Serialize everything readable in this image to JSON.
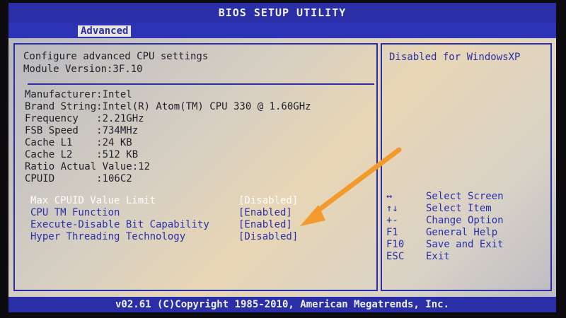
{
  "title": "BIOS SETUP UTILITY",
  "tab": "Advanced",
  "header": {
    "line1": "Configure advanced CPU settings",
    "line2": "Module Version:3F.10"
  },
  "info": [
    "Manufacturer:Intel",
    "Brand String:Intel(R) Atom(TM) CPU 330 @ 1.60GHz",
    "Frequency   :2.21GHz",
    "FSB Speed   :734MHz",
    "Cache L1    :24 KB",
    "Cache L2    :512 KB",
    "Ratio Actual Value:12",
    "CPUID       :106C2"
  ],
  "options": [
    {
      "label": "Max CPUID Value Limit",
      "value": "[Disabled]"
    },
    {
      "label": "CPU TM Function",
      "value": "[Enabled]"
    },
    {
      "label": "Execute-Disable Bit Capability",
      "value": "[Enabled]"
    },
    {
      "label": "Hyper Threading Technology",
      "value": "[Disabled]"
    }
  ],
  "help_text": "Disabled for WindowsXP",
  "keys": [
    {
      "key": "↔",
      "action": "Select Screen"
    },
    {
      "key": "↑↓",
      "action": "Select Item"
    },
    {
      "key": "+-",
      "action": "Change Option"
    },
    {
      "key": "F1",
      "action": "General Help"
    },
    {
      "key": "F10",
      "action": "Save and Exit"
    },
    {
      "key": "ESC",
      "action": "Exit"
    }
  ],
  "footer": "v02.61 (C)Copyright 1985-2010, American Megatrends, Inc.",
  "colors": {
    "bios_blue": "#2a2fa8",
    "highlight_white": "#fdfdfd",
    "arrow_orange": "#f39a2e"
  }
}
